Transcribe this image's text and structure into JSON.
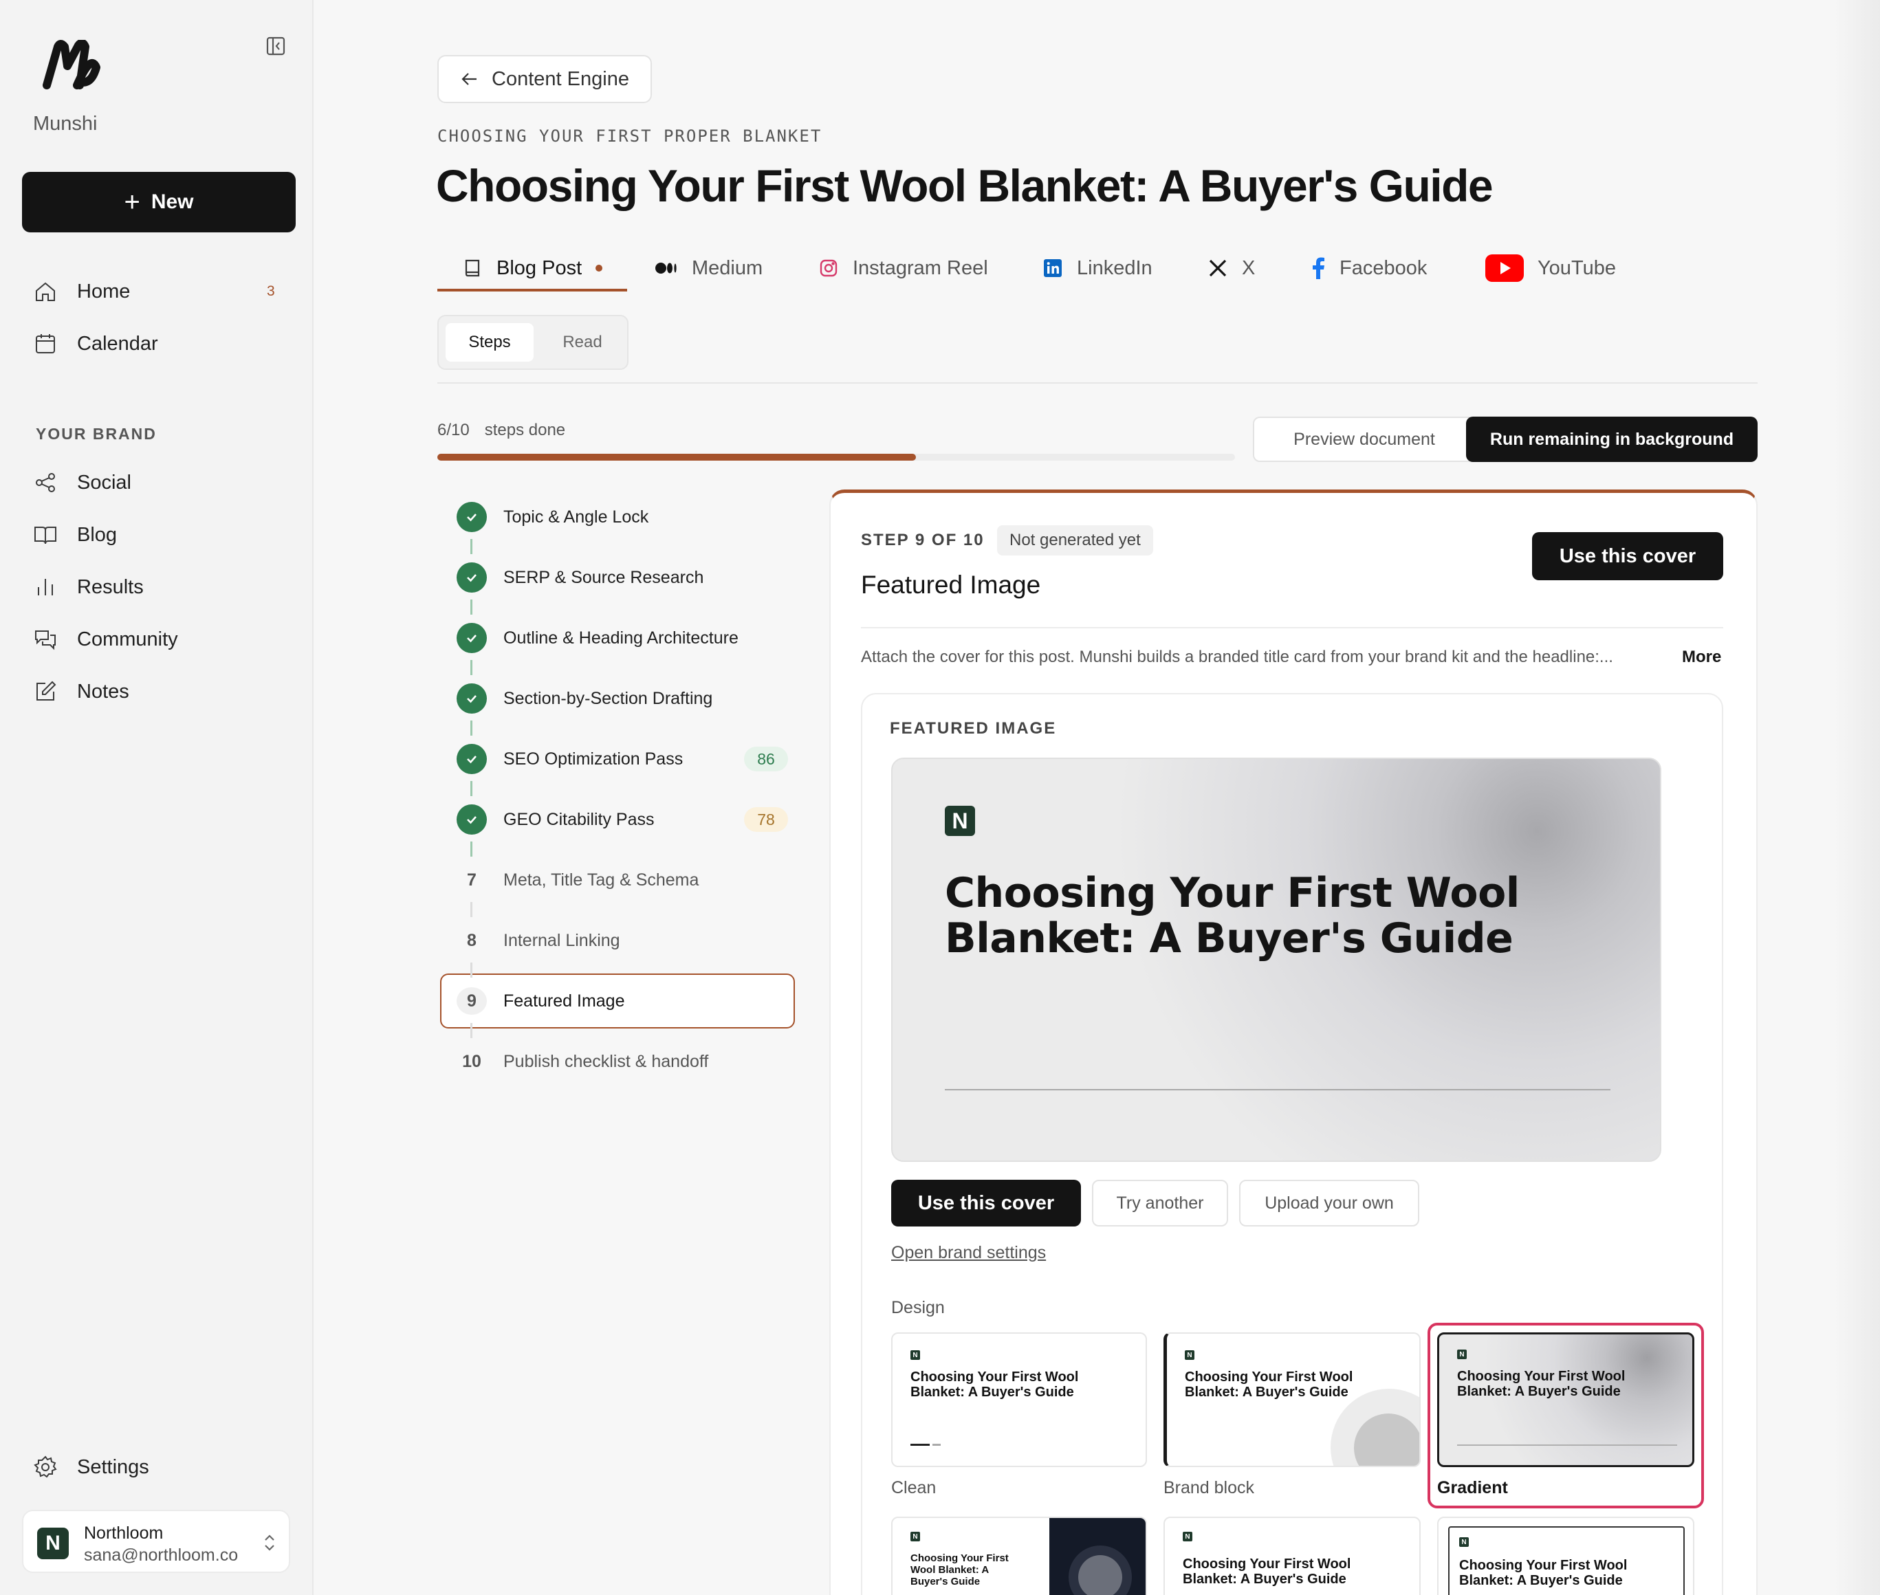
{
  "app": {
    "name": "Munshi"
  },
  "sidebar": {
    "new_label": "New",
    "items": [
      {
        "label": "Home",
        "badge": "3"
      },
      {
        "label": "Calendar"
      }
    ],
    "brand_heading": "YOUR BRAND",
    "brand_items": [
      {
        "label": "Social"
      },
      {
        "label": "Blog"
      },
      {
        "label": "Results"
      },
      {
        "label": "Community"
      },
      {
        "label": "Notes"
      }
    ],
    "settings_label": "Settings",
    "account": {
      "initial": "N",
      "name": "Northloom",
      "email": "sana@northloom.co"
    }
  },
  "header": {
    "back_label": "Content Engine",
    "eyebrow": "CHOOSING YOUR FIRST PROPER BLANKET",
    "title": "Choosing Your First Wool Blanket: A Buyer's Guide"
  },
  "channels": [
    {
      "label": "Blog Post",
      "icon": "book-icon"
    },
    {
      "label": "Medium",
      "icon": "medium-icon"
    },
    {
      "label": "Instagram Reel",
      "icon": "instagram-icon"
    },
    {
      "label": "LinkedIn",
      "icon": "linkedin-icon"
    },
    {
      "label": "X",
      "icon": "x-icon"
    },
    {
      "label": "Facebook",
      "icon": "facebook-icon"
    },
    {
      "label": "YouTube",
      "icon": "youtube-icon"
    }
  ],
  "view_toggle": {
    "steps": "Steps",
    "read": "Read"
  },
  "progress": {
    "count": "6/10",
    "label": "steps done",
    "fraction": 0.6
  },
  "actions": {
    "preview": "Preview document",
    "run": "Run remaining in background"
  },
  "steps": [
    {
      "label": "Topic & Angle Lock",
      "done": true
    },
    {
      "label": "SERP & Source Research",
      "done": true
    },
    {
      "label": "Outline & Heading Architecture",
      "done": true
    },
    {
      "label": "Section-by-Section Drafting",
      "done": true
    },
    {
      "label": "SEO Optimization Pass",
      "done": true,
      "score": "86"
    },
    {
      "label": "GEO Citability Pass",
      "done": true,
      "score": "78"
    },
    {
      "label": "Meta, Title Tag & Schema",
      "num": "7"
    },
    {
      "label": "Internal Linking",
      "num": "8"
    },
    {
      "label": "Featured Image",
      "num": "9"
    },
    {
      "label": "Publish checklist & handoff",
      "num": "10"
    }
  ],
  "panel": {
    "step_label": "STEP 9 OF 10",
    "status": "Not generated yet",
    "title": "Featured Image",
    "use_cover": "Use this cover",
    "description": "Attach the cover for this post. Munshi builds a branded title card from your brand kit and the headline:...",
    "more": "More",
    "card_heading": "FEATURED IMAGE",
    "preview_logo": "N",
    "preview_title_1": "Choosing Your First Wool",
    "preview_title_2": "Blanket: A Buyer's Guide",
    "buttons": {
      "use": "Use this cover",
      "try": "Try another",
      "upload": "Upload your own"
    },
    "brand_link": "Open brand settings",
    "design_label": "Design",
    "designs": [
      {
        "name": "Clean",
        "title": "Choosing Your First Wool Blanket: A Buyer's Guide"
      },
      {
        "name": "Brand block",
        "title": "Choosing Your First Wool Blanket: A Buyer's Guide"
      },
      {
        "name": "Gradient",
        "title": "Choosing Your First Wool Blanket: A Buyer's Guide"
      }
    ],
    "designs_row2": [
      {
        "title": "Choosing Your First Wool Blanket: A Buyer's Guide"
      },
      {
        "title": "Choosing Your First Wool Blanket: A Buyer's Guide"
      },
      {
        "title": "Choosing Your First Wool Blanket: A Buyer's Guide"
      }
    ]
  },
  "colors": {
    "accent": "#a5522b",
    "success": "#2e7d4f",
    "selected": "#d8345f"
  }
}
